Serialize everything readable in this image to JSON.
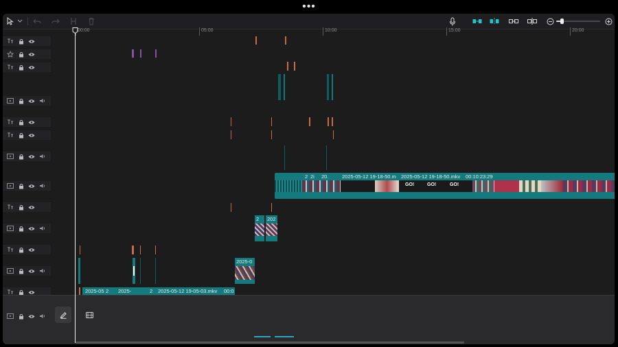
{
  "timeline": {
    "ruler_labels": [
      "00:00",
      "05:00",
      "10:00",
      "15:00",
      "20:00"
    ]
  },
  "clips": {
    "main_file": "2025-05-12 19-18-50.mkv",
    "main_file_trunc": "2025-05-12 19-18-50.m",
    "main_duration": "00:10:23:29",
    "short_2": "2",
    "short_2i": "2i",
    "short_20": "20.",
    "short_202": "202",
    "short_2025_0": "2025-0",
    "short_2025_05": "2025-05",
    "short_2025": "2025-",
    "bottom_file": "2025-05-12 19-05-03.mkv",
    "bottom_duration": "00:0",
    "thumb_text": "GO!"
  },
  "colors": {
    "accent": "#21c6cc",
    "clip_teal": "#157a7e",
    "clip_teal_dark": "#0e5d61",
    "marker_orange": "#c96a4a",
    "marker_purple": "#8a4fa8",
    "marker_white": "#ffffff"
  },
  "icons": {
    "select_tool": "cursor-arrow",
    "undo": "undo-arrow",
    "redo": "redo-arrow",
    "split": "split-scissors",
    "delete": "trash-can",
    "microphone": "microphone",
    "zoom_out": "zoom-minus",
    "zoom_in": "zoom-plus"
  },
  "zoom": {
    "level": 0.12
  }
}
